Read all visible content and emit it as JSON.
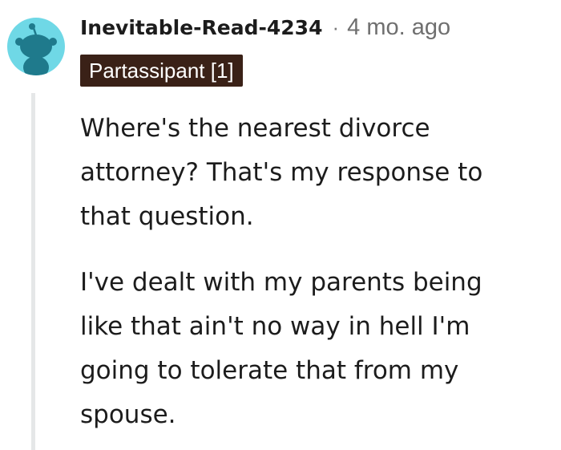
{
  "comment": {
    "author": "Inevitable-Read-4234",
    "separator": "·",
    "timestamp": "4 mo. ago",
    "flair": "Partassipant [1]",
    "avatar_icon": "reddit-snoo-icon",
    "body": {
      "paragraph1": [
        "Where's the nearest divorce",
        "attorney? That's my response to",
        "that question."
      ],
      "paragraph2": [
        "I've dealt with my parents being",
        "like that ain't no way in hell I'm",
        "going to tolerate that from my",
        "spouse."
      ]
    }
  },
  "colors": {
    "avatar_bg": "#6fd8e6",
    "flair_bg": "#3a2117",
    "text": "#1c1c1c",
    "meta": "#6f6f6f",
    "thread_line": "#e5e7e8"
  }
}
